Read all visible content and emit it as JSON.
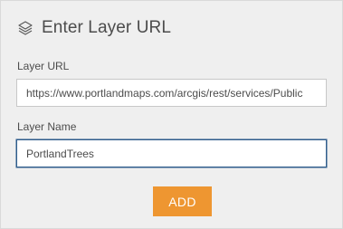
{
  "header": {
    "icon": "layers-icon",
    "title": "Enter Layer URL"
  },
  "form": {
    "url_label": "Layer URL",
    "url_value": "https://www.portlandmaps.com/arcgis/rest/services/Public",
    "name_label": "Layer Name",
    "name_value": "PortlandTrees"
  },
  "actions": {
    "add_label": "ADD"
  },
  "colors": {
    "accent": "#ee9631",
    "focus_border": "#2f5d8c",
    "panel_bg": "#efefef",
    "text": "#4c4c4c"
  }
}
